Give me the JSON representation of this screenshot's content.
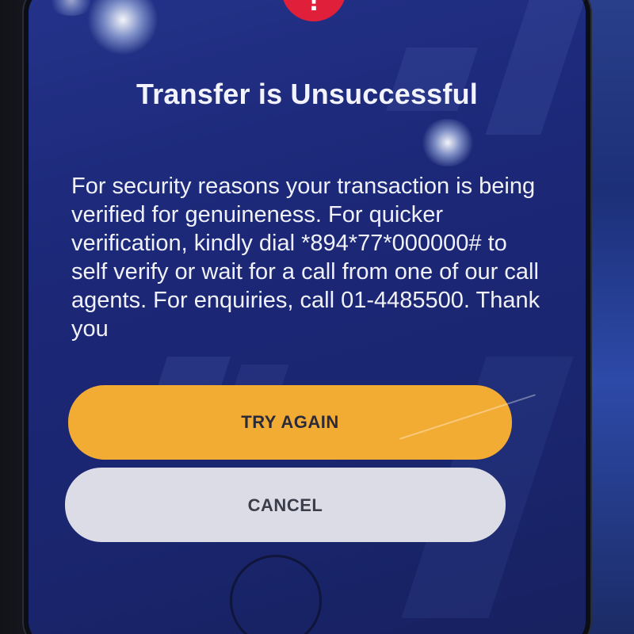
{
  "dialog": {
    "title": "Transfer is Unsuccessful",
    "icon": "alert-icon",
    "icon_glyph": "!",
    "message": "For security reasons your transaction is being verified for genuineness. For quicker verification, kindly dial *894*77*000000# to self verify or wait for a call from one of our call agents. For enquiries, call 01-4485500. Thank you"
  },
  "buttons": {
    "try_again_label": "TRY AGAIN",
    "cancel_label": "CANCEL"
  },
  "colors": {
    "background": "#1c2878",
    "alert": "#e0203a",
    "primary_button": "#f3ac33",
    "secondary_button": "#dcdce6"
  }
}
